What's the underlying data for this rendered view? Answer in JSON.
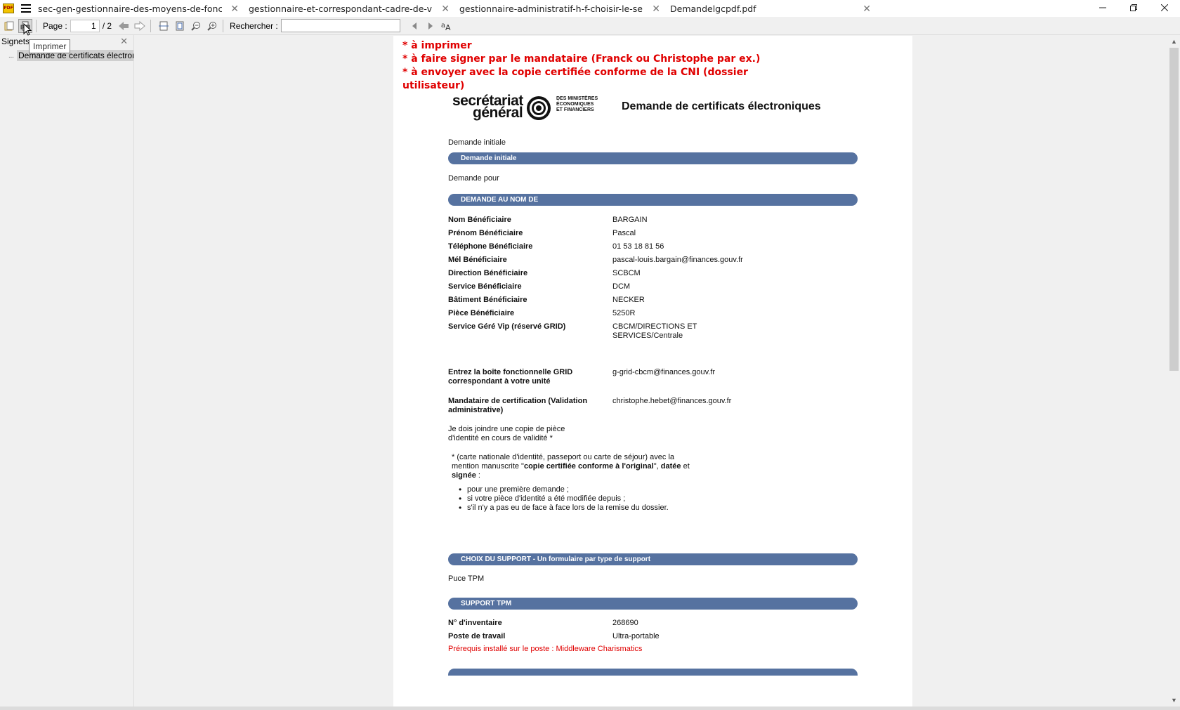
{
  "tabs": [
    {
      "label": "sec-gen-gestionnaire-des-moyens-de-fonctionn..."
    },
    {
      "label": "gestionnaire-et-correspondant-cadre-de-vie-sg-..."
    },
    {
      "label": "gestionnaire-administratif-h-f-choisir-le-service-..."
    },
    {
      "label": "Demandelgcpdf.pdf"
    }
  ],
  "toolbar": {
    "page_label": "Page :",
    "page_value": "1",
    "page_total": "/ 2",
    "search_label": "Rechercher :",
    "print_tooltip": "Imprimer"
  },
  "sidebar": {
    "title": "Signets",
    "bookmark": "Demande de certificats électroniques"
  },
  "document": {
    "notes": [
      "* à imprimer",
      "* à faire signer par le mandataire (Franck ou Christophe par ex.)",
      "* à envoyer avec la copie certifiée conforme de la CNI (dossier",
      "utilisateur)"
    ],
    "logo_line1": "secrétariat",
    "logo_line2": "général",
    "logo_min": [
      "DES MINISTÈRES",
      "ÉCONOMIQUES",
      "ET FINANCIERS"
    ],
    "title": "Demande de certificats électroniques",
    "demande_type": "Demande initiale",
    "bar1": "Demande initiale",
    "demande_pour": "Demande pour",
    "bar2": "DEMANDE AU NOM DE",
    "fields": [
      {
        "label": "Nom Bénéficiaire",
        "value": "BARGAIN"
      },
      {
        "label": "Prénom Bénéficiaire",
        "value": "Pascal"
      },
      {
        "label": "Téléphone Bénéficiaire",
        "value": "01 53 18 81 56"
      },
      {
        "label": "Mél Bénéficiaire",
        "value": "pascal-louis.bargain@finances.gouv.fr"
      },
      {
        "label": "Direction Bénéficiaire",
        "value": "SCBCM"
      },
      {
        "label": "Service Bénéficiaire",
        "value": "DCM"
      },
      {
        "label": "Bâtiment Bénéficiaire",
        "value": "NECKER"
      },
      {
        "label": "Pièce Bénéficiaire",
        "value": "5250R"
      },
      {
        "label": "Service Géré Vip (réservé GRID)",
        "value": "CBCM/DIRECTIONS ET",
        "value2": "SERVICES/Centrale"
      }
    ],
    "grid_label1": "Entrez la boîte fonctionnelle GRID",
    "grid_label2": "correspondant à votre unité",
    "grid_value": "g-grid-cbcm@finances.gouv.fr",
    "mandataire_label1": "Mandataire de certification (Validation",
    "mandataire_label2": "administrative)",
    "mandataire_value": "christophe.hebet@finances.gouv.fr",
    "piece_line1": "Je dois joindre une copie de pièce",
    "piece_line2": "d'identité en cours de validité *",
    "note_line1": "* (carte nationale d'identité, passeport ou carte de séjour) avec la",
    "note_line2a": "mention manuscrite \"",
    "note_line2b": "copie certifiée conforme à l'original",
    "note_line2c": "\",",
    "note_line2d": "datée",
    "note_line2e": " et",
    "note_line3a": "signée",
    "note_line3b": " :",
    "bullets": [
      "pour une première demande ;",
      "si votre pièce d'identité a été modifiée depuis ;",
      "s'il n'y a pas eu de face à face lors de la remise du dossier."
    ],
    "bar3": "CHOIX DU SUPPORT - Un formulaire par type de support",
    "support": "Puce TPM",
    "bar4": "SUPPORT TPM",
    "inventaire_label": "N° d'inventaire",
    "inventaire_value": "268690",
    "poste_label": "Poste de travail",
    "poste_value": "Ultra-portable",
    "prerequis": "Prérequis installé sur le poste : Middleware Charismatics"
  },
  "colors": {
    "bar": "#5672a0",
    "note_red": "#e00000"
  }
}
